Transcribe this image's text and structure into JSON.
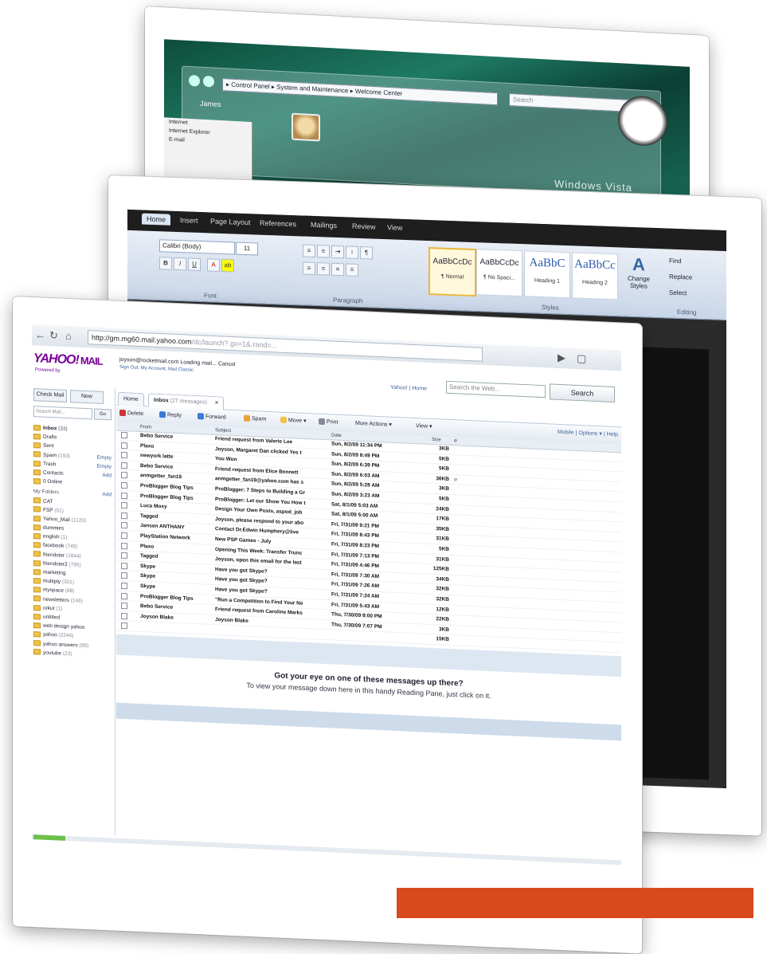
{
  "vista": {
    "address": "▸ Control Panel ▸ System and Maintenance ▸ Welcome Center",
    "search_placeholder": "Search",
    "window_title": "James",
    "start_menu": [
      "Internet",
      "Internet Explorer",
      "E-mail"
    ],
    "brand": "Windows Vista"
  },
  "word": {
    "tabs": [
      "Home",
      "Insert",
      "Page Layout",
      "References",
      "Mailings",
      "Review",
      "View"
    ],
    "font_name": "Calibri (Body)",
    "font_size": "11",
    "groups": [
      "Font",
      "Paragraph",
      "Styles",
      "Editing"
    ],
    "styles": [
      {
        "sample": "AaBbCcDc",
        "name": "¶ Normal"
      },
      {
        "sample": "AaBbCcDc",
        "name": "¶ No Spaci..."
      },
      {
        "sample": "AaBbC",
        "name": "Heading 1"
      },
      {
        "sample": "AaBbCc",
        "name": "Heading 2"
      }
    ],
    "change_styles": "Change Styles",
    "editing": [
      "Find",
      "Replace",
      "Select"
    ]
  },
  "browser": {
    "url_host": "http://gm.mg60.mail.yahoo.com",
    "url_rest": "/dc/launch?.gx=1&.rand=..."
  },
  "yahoo": {
    "logo": "YAHOO!",
    "logo_mail": "MAIL",
    "logo_sub": "Powered by",
    "user_line": "joyson@rocketmail.com  Loading mail... Cancel",
    "user_links": "Sign Out, My Account, Mail Classic",
    "top_links": "Yahoo! | Home",
    "search_placeholder": "Search the Web...",
    "search_button": "Search",
    "check_mail": "Check Mail",
    "new": "New",
    "search_mail": "Search Mail...",
    "go": "Go",
    "folders": [
      {
        "name": "Inbox",
        "count": "(33)",
        "bold": true
      },
      {
        "name": "Drafts",
        "count": ""
      },
      {
        "name": "Sent",
        "count": ""
      },
      {
        "name": "Spam",
        "count": "(193)",
        "action": "Empty"
      },
      {
        "name": "Trash",
        "count": "",
        "action": "Empty"
      },
      {
        "name": "Contacts",
        "count": "",
        "action": "Add"
      },
      {
        "name": "0 Online",
        "count": ""
      },
      {
        "name": "My Folders",
        "count": "",
        "action": "Add",
        "section": true
      },
      {
        "name": "CAT",
        "count": ""
      },
      {
        "name": "FSP",
        "count": "(51)"
      },
      {
        "name": "Yahoo_Mail",
        "count": "(1120)"
      },
      {
        "name": "dummies",
        "count": ""
      },
      {
        "name": "english",
        "count": "(1)"
      },
      {
        "name": "facebook",
        "count": "(745)"
      },
      {
        "name": "friendster",
        "count": "(1844)"
      },
      {
        "name": "friendster2",
        "count": "(795)"
      },
      {
        "name": "marketing",
        "count": ""
      },
      {
        "name": "multiply",
        "count": "(301)"
      },
      {
        "name": "myspace",
        "count": "(88)"
      },
      {
        "name": "newsletters",
        "count": "(146)"
      },
      {
        "name": "orkut",
        "count": "(1)"
      },
      {
        "name": "untitled",
        "count": ""
      },
      {
        "name": "web design yahoo",
        "count": ""
      },
      {
        "name": "yahoo",
        "count": "(2244)"
      },
      {
        "name": "yahoo answers",
        "count": "(99)"
      },
      {
        "name": "youtube",
        "count": "(23)"
      }
    ],
    "tabs": {
      "home": "Home",
      "inbox": "Inbox",
      "inbox_count": "(27 messages)",
      "close": "×"
    },
    "toolbar": [
      "Delete",
      "Reply",
      "Forward",
      "Spam",
      "Move",
      "Print",
      "More Actions",
      "View"
    ],
    "mobile_opts": "Mobile | Options ▾ | Help",
    "columns": {
      "from": "From",
      "subject": "Subject",
      "date": "Date",
      "size": "Size"
    },
    "messages": [
      {
        "from": "Bebo Service",
        "subject": "Friend request from Valerie Lee",
        "date": "Sun, 8/2/09 11:34 PM",
        "size": "3KB"
      },
      {
        "from": "Plaxo",
        "subject": "Joyson, Margaret Dan clicked Yes t",
        "date": "Sun, 8/2/09 8:49 PM",
        "size": "5KB"
      },
      {
        "from": "newyork latte",
        "subject": "You Won",
        "date": "Sun, 8/2/09 6:39 PM",
        "size": "5KB"
      },
      {
        "from": "Bebo Service",
        "subject": "Friend request from Elice Bennett",
        "date": "Sun, 8/2/09 6:03 AM",
        "size": "36KB",
        "clip": true
      },
      {
        "from": "anmgetter_fan19",
        "subject": "anmgetter_fan19@yahoo.com has s",
        "date": "Sun, 8/2/09 5:28 AM",
        "size": "3KB"
      },
      {
        "from": "ProBlogger Blog Tips",
        "subject": "ProBlogger: 7 Steps to Building a Gr",
        "date": "Sun, 8/2/09 3:23 AM",
        "size": "5KB"
      },
      {
        "from": "ProBlogger Blog Tips",
        "subject": "ProBlogger: Let our Show You How t",
        "date": "Sat, 8/1/09 5:03 AM",
        "size": "24KB"
      },
      {
        "from": "Luca Moxy",
        "subject": "Design Your Own Posts, aspod_job",
        "date": "Sat, 8/1/09 5:00 AM",
        "size": "17KB"
      },
      {
        "from": "Tagged",
        "subject": "Joyson, please respond to your abo",
        "date": "Fri, 7/31/09 9:21 PM",
        "size": "35KB"
      },
      {
        "from": "Jansen ANTHANY",
        "subject": "Contact Dr.Edwin Humphery@live",
        "date": "Fri, 7/31/09 8:43 PM",
        "size": "31KB"
      },
      {
        "from": "PlayStation Network",
        "subject": "New PSP Games - July",
        "date": "Fri, 7/31/09 8:23 PM",
        "size": "5KB"
      },
      {
        "from": "Plaxo",
        "subject": "Opening This Week: Transfer Trunc",
        "date": "Fri, 7/31/09 7:13 PM",
        "size": "31KB"
      },
      {
        "from": "Tagged",
        "subject": "Joyson, open this email for the last",
        "date": "Fri, 7/31/09 4:46 PM",
        "size": "125KB"
      },
      {
        "from": "Skype",
        "subject": "Have you got Skype?",
        "date": "Fri, 7/31/09 7:30 AM",
        "size": "34KB"
      },
      {
        "from": "Skype",
        "subject": "Have you got Skype?",
        "date": "Fri, 7/31/09 7:26 AM",
        "size": "32KB"
      },
      {
        "from": "Skype",
        "subject": "Have you got Skype?",
        "date": "Fri, 7/31/09 7:24 AM",
        "size": "32KB"
      },
      {
        "from": "ProBlogger Blog Tips",
        "subject": "\"Run a Competition to Find Your Ne",
        "date": "Fri, 7/31/09 5:43 AM",
        "size": "12KB"
      },
      {
        "from": "Bebo Service",
        "subject": "Friend request from Caroline Marks",
        "date": "Thu, 7/30/09 8:00 PM",
        "size": "22KB"
      },
      {
        "from": "Joyson Blake",
        "subject": "Joyson Blake",
        "date": "Thu, 7/30/09 7:07 PM",
        "size": "3KB"
      },
      {
        "from": "",
        "subject": "",
        "date": "",
        "size": "15KB"
      }
    ],
    "reading_pane_line1": "Got your eye on one of these messages up there?",
    "reading_pane_line2": "To view your message down here in this handy Reading Pane, just click on it."
  },
  "colors": {
    "banner": "#d84a1b",
    "yahoo_purple": "#7b0099",
    "vista_green": "#1e7a63"
  }
}
